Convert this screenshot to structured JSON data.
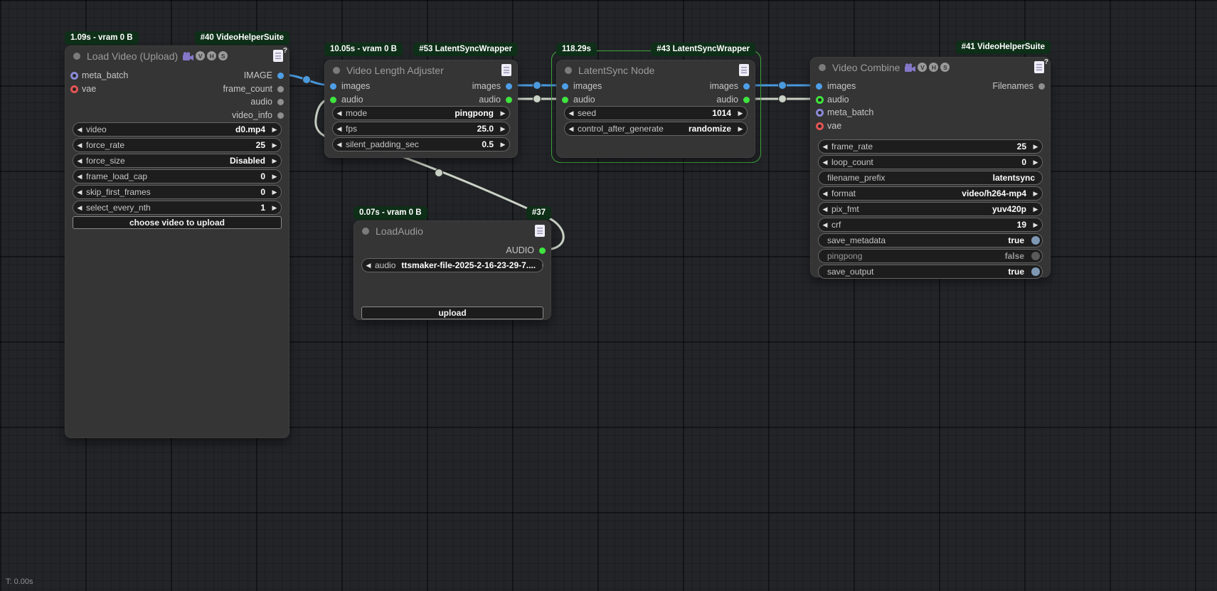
{
  "status_bar": {
    "total_time": "T: 0.00s"
  },
  "icons": {
    "help_mark": "?",
    "vhs_letters": [
      "V",
      "H",
      "S"
    ]
  },
  "colors": {
    "link_image": "#4b9ade",
    "link_audio": "#c9d2c5",
    "slot_image": "#4f9fe8",
    "slot_audio": "#3fe53f",
    "slot_vae": "#e25555",
    "slot_meta_batch": "#8a8ad6",
    "slot_generic": "#8f8f8f",
    "running_outline": "#3fae3f",
    "badge_background": "#0e2f18",
    "node_background": "#353535",
    "toggle_on": "#7e98b4"
  },
  "nodes": {
    "load_video": {
      "badges": {
        "time": "1.09s - vram 0 B",
        "id": "#40 VideoHelperSuite"
      },
      "title": "Load Video (Upload)",
      "inputs": [
        {
          "label": "meta_batch"
        },
        {
          "label": "vae"
        }
      ],
      "outputs": [
        {
          "label": "IMAGE"
        },
        {
          "label": "frame_count"
        },
        {
          "label": "audio"
        },
        {
          "label": "video_info"
        }
      ],
      "widgets": [
        {
          "label": "video",
          "value": "d0.mp4"
        },
        {
          "label": "force_rate",
          "value": "25"
        },
        {
          "label": "force_size",
          "value": "Disabled"
        },
        {
          "label": "frame_load_cap",
          "value": "0"
        },
        {
          "label": "skip_first_frames",
          "value": "0"
        },
        {
          "label": "select_every_nth",
          "value": "1"
        }
      ],
      "upload_button": "choose video to upload"
    },
    "video_length_adjuster": {
      "badges": {
        "time": "10.05s - vram 0 B",
        "id": "#53 LatentSyncWrapper"
      },
      "title": "Video Length Adjuster",
      "inputs": [
        {
          "label": "images"
        },
        {
          "label": "audio"
        }
      ],
      "outputs": [
        {
          "label": "images"
        },
        {
          "label": "audio"
        }
      ],
      "widgets": [
        {
          "label": "mode",
          "value": "pingpong"
        },
        {
          "label": "fps",
          "value": "25.0"
        },
        {
          "label": "silent_padding_sec",
          "value": "0.5"
        }
      ]
    },
    "latentsync": {
      "badges": {
        "time": "118.29s",
        "id": "#43 LatentSyncWrapper"
      },
      "title": "LatentSync Node",
      "inputs": [
        {
          "label": "images"
        },
        {
          "label": "audio"
        }
      ],
      "outputs": [
        {
          "label": "images"
        },
        {
          "label": "audio"
        }
      ],
      "widgets": [
        {
          "label": "seed",
          "value": "1014"
        },
        {
          "label": "control_after_generate",
          "value": "randomize"
        }
      ]
    },
    "video_combine": {
      "badges": {
        "id": "#41 VideoHelperSuite"
      },
      "title": "Video Combine",
      "inputs": [
        {
          "label": "images"
        },
        {
          "label": "audio"
        },
        {
          "label": "meta_batch"
        },
        {
          "label": "vae"
        }
      ],
      "outputs": [
        {
          "label": "Filenames"
        }
      ],
      "widgets": [
        {
          "label": "frame_rate",
          "value": "25"
        },
        {
          "label": "loop_count",
          "value": "0"
        },
        {
          "label": "filename_prefix",
          "value": "latentsync"
        },
        {
          "label": "format",
          "value": "video/h264-mp4"
        },
        {
          "label": "pix_fmt",
          "value": "yuv420p"
        },
        {
          "label": "crf",
          "value": "19"
        },
        {
          "label": "save_metadata",
          "value": "true"
        },
        {
          "label": "pingpong",
          "value": "false"
        },
        {
          "label": "save_output",
          "value": "true"
        }
      ]
    },
    "load_audio": {
      "badges": {
        "time": "0.07s - vram 0 B",
        "id": "#37"
      },
      "title": "LoadAudio",
      "outputs": [
        {
          "label": "AUDIO"
        }
      ],
      "widgets": [
        {
          "label": "audio",
          "value": "ttsmaker-file-2025-2-16-23-29-7...."
        }
      ],
      "upload_button": "upload"
    }
  }
}
